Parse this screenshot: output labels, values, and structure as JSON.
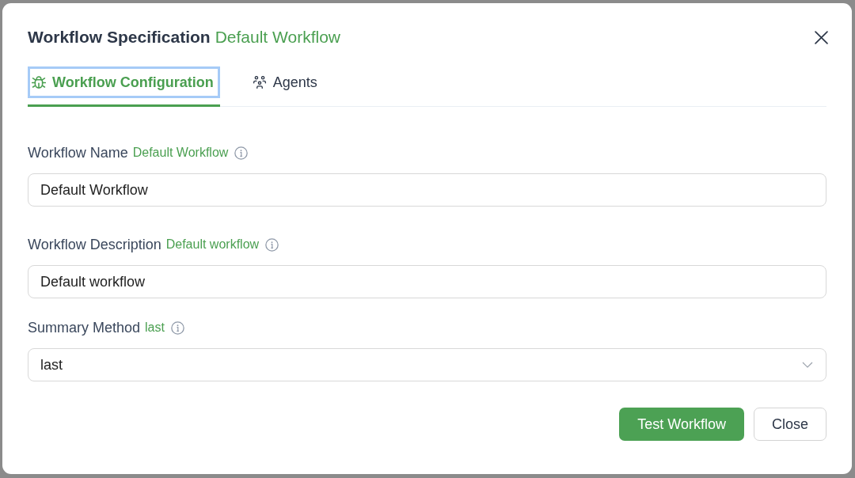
{
  "dialog": {
    "title": "Workflow Specification",
    "subtitle": "Default Workflow"
  },
  "tabs": [
    {
      "label": "Workflow Configuration",
      "selected": true,
      "focused": true
    },
    {
      "label": "Agents",
      "selected": false,
      "focused": false
    }
  ],
  "fields": [
    {
      "kind": "text",
      "label": "Workflow Name",
      "hint": "Default Workflow",
      "value": "Default Workflow"
    },
    {
      "kind": "text",
      "label": "Workflow Description",
      "hint": "Default workflow",
      "value": "Default workflow"
    },
    {
      "kind": "select",
      "label": "Summary Method",
      "hint": "last",
      "value": "last"
    }
  ],
  "buttons": [
    {
      "label": "Test Workflow",
      "kind": "primary"
    },
    {
      "label": "Close",
      "kind": "secondary"
    }
  ]
}
